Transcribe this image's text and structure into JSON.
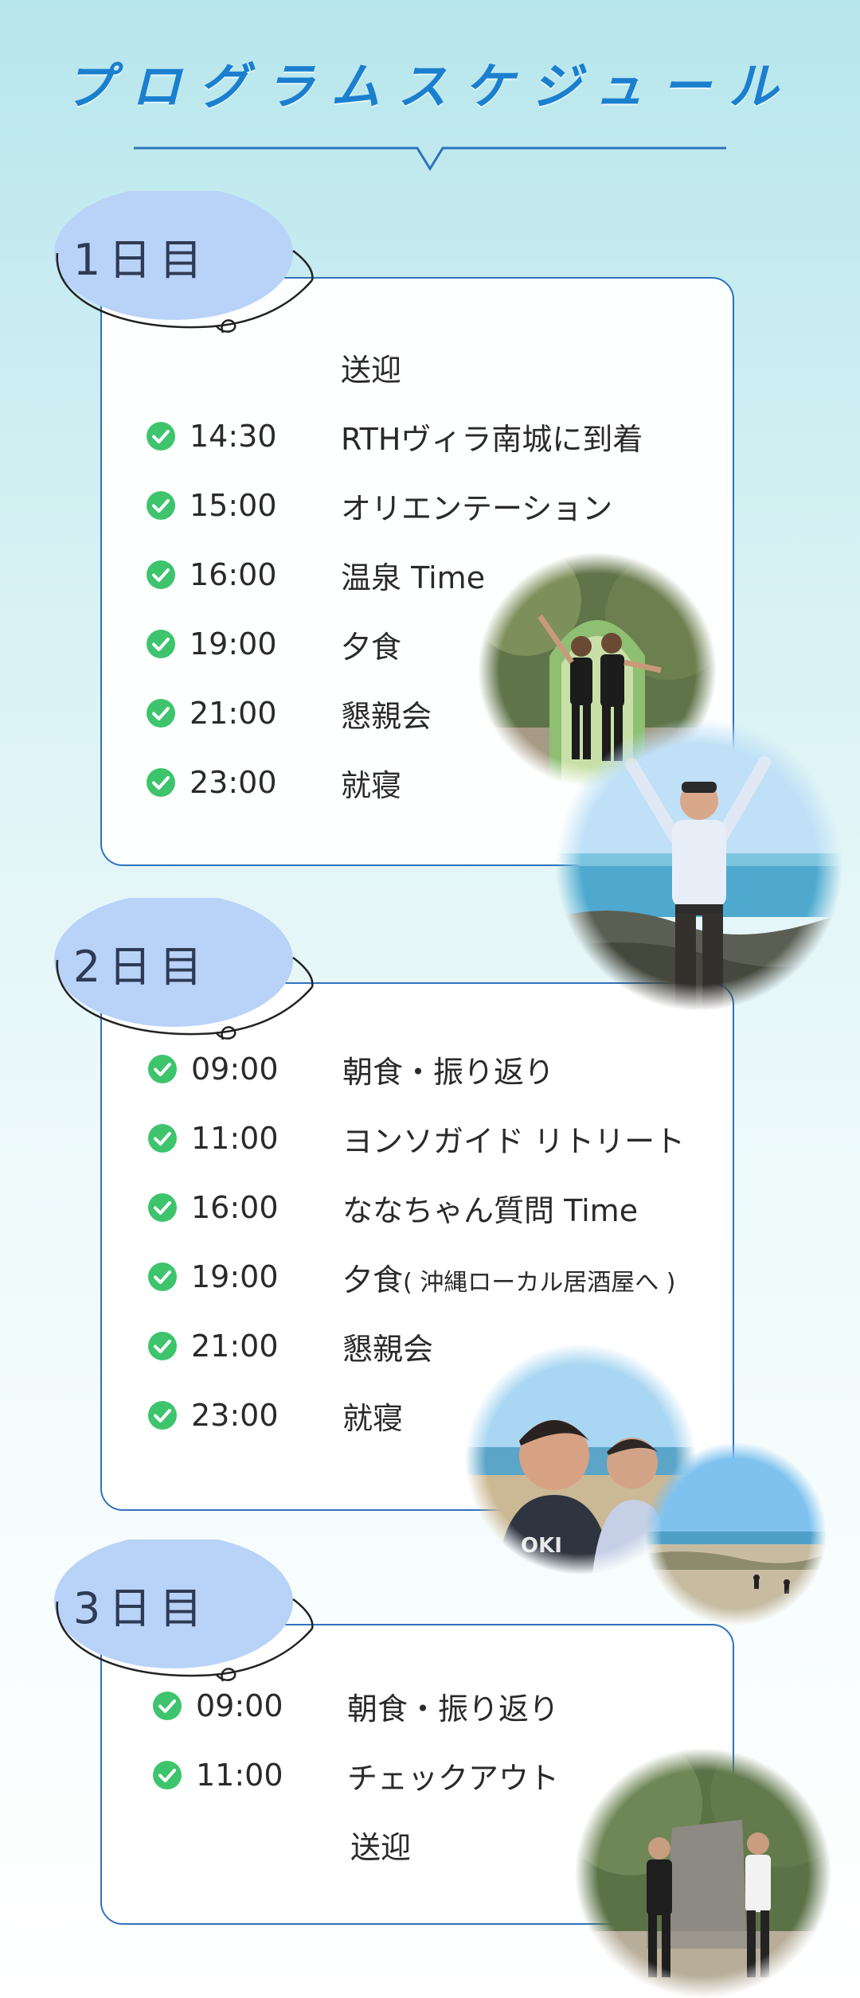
{
  "page_title": "プログラムスケジュール",
  "colors": {
    "accent": "#2f72bd",
    "title": "#1b7fcf",
    "badge": "#b9d2f8",
    "check": "#3ec46d"
  },
  "days": [
    {
      "label": "1日目",
      "items": [
        {
          "time": "",
          "activity": "送迎",
          "note": "",
          "checked": false
        },
        {
          "time": "14:30",
          "activity": "RTHヴィラ南城に到着",
          "note": "",
          "checked": true
        },
        {
          "time": "15:00",
          "activity": "オリエンテーション",
          "note": "",
          "checked": true
        },
        {
          "time": "16:00",
          "activity": "温泉 Time",
          "note": "",
          "checked": true
        },
        {
          "time": "19:00",
          "activity": "夕食",
          "note": "",
          "checked": true
        },
        {
          "time": "21:00",
          "activity": "懇親会",
          "note": "",
          "checked": true
        },
        {
          "time": "23:00",
          "activity": "就寝",
          "note": "",
          "checked": true
        }
      ]
    },
    {
      "label": "2日目",
      "items": [
        {
          "time": "09:00",
          "activity": "朝食・振り返り",
          "note": "",
          "checked": true
        },
        {
          "time": "11:00",
          "activity": "ヨンソガイド リトリート",
          "note": "",
          "checked": true
        },
        {
          "time": "16:00",
          "activity": "ななちゃん質問 Time",
          "note": "",
          "checked": true
        },
        {
          "time": "19:00",
          "activity": "夕食",
          "note": "( 沖縄ローカル居酒屋へ )",
          "checked": true
        },
        {
          "time": "21:00",
          "activity": "懇親会",
          "note": "",
          "checked": true
        },
        {
          "time": "23:00",
          "activity": "就寝",
          "note": "",
          "checked": true
        }
      ]
    },
    {
      "label": "3日目",
      "items": [
        {
          "time": "09:00",
          "activity": "朝食・振り返り",
          "note": "",
          "checked": true
        },
        {
          "time": "11:00",
          "activity": "チェックアウト",
          "note": "",
          "checked": true
        },
        {
          "time": "",
          "activity": "送迎",
          "note": "",
          "checked": false
        }
      ]
    }
  ],
  "photos": [
    {
      "name": "photo-two-men-stone-arch",
      "icon": "photo-icon"
    },
    {
      "name": "photo-man-arms-raised-sea",
      "icon": "photo-icon"
    },
    {
      "name": "photo-selfie-two-men-beach",
      "icon": "photo-icon"
    },
    {
      "name": "photo-beach-shore",
      "icon": "photo-icon"
    },
    {
      "name": "photo-two-men-stone-monument",
      "icon": "photo-icon"
    }
  ]
}
